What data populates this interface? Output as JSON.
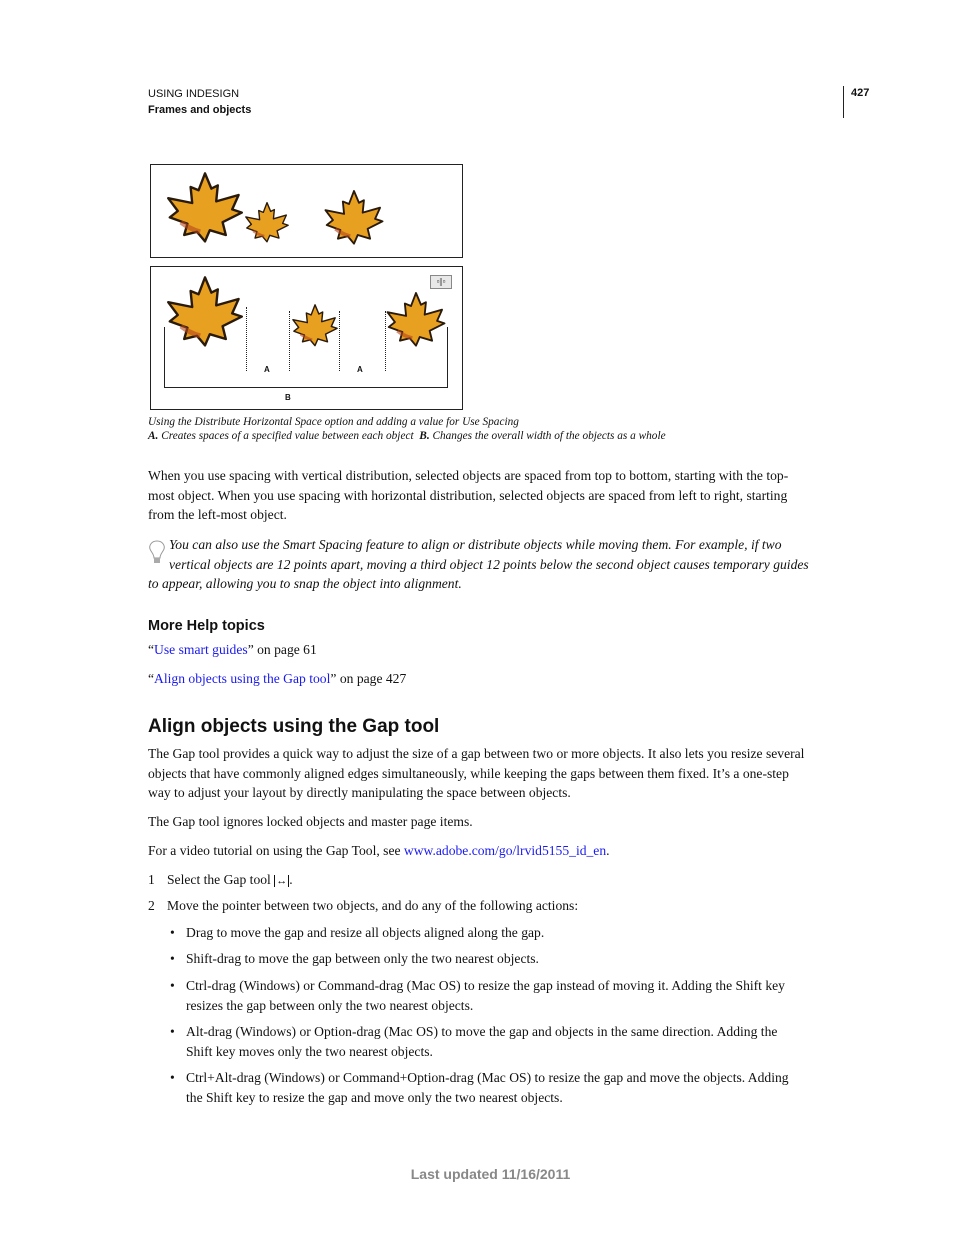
{
  "header": {
    "book": "USING INDESIGN",
    "chapter": "Frames and objects",
    "page_number": "427"
  },
  "figure": {
    "labels": {
      "a1": "A",
      "a2": "A",
      "b": "B"
    },
    "caption_line1": "Using the Distribute Horizontal Space option and adding a value for Use Spacing",
    "caption_a_key": "A.",
    "caption_a_text": "Creates spaces of a specified value between each object",
    "caption_b_key": "B.",
    "caption_b_text": "Changes the overall width of the objects as a whole",
    "leaf_color": "#e8a020",
    "icon": "distribute-horizontal-space-icon"
  },
  "para1": [
    "When you use spacing with vertical distribution, selected objects are spaced from top to bottom, starting with the top-",
    "most object. When you use spacing with horizontal distribution, selected objects are spaced from left to right, starting",
    "from the left-most object."
  ],
  "tip": {
    "icon": "lightbulb-icon",
    "lines": [
      "You can also use the Smart Spacing feature to align or distribute objects while moving them. For example, if two",
      "vertical objects are 12 points apart, moving a third object 12 points below the second object causes temporary guides",
      "to appear, allowing you to snap the object into alignment."
    ]
  },
  "more_help": {
    "title": "More Help topics",
    "links": [
      {
        "text": "Use smart guides",
        "suffix": " on page 61"
      },
      {
        "text": "Align objects using the Gap tool",
        "suffix": " on page 427"
      }
    ]
  },
  "section": {
    "title": "Align objects using the Gap tool",
    "para1": [
      "The Gap tool provides a quick way to adjust the size of a gap between two or more objects. It also lets you resize several",
      "objects that have commonly aligned edges simultaneously, while keeping the gaps between them fixed. It’s a one-step",
      "way to adjust your layout by directly manipulating the space between objects."
    ],
    "para2": "The Gap tool ignores locked objects and master page items.",
    "para3_prefix": "For a video tutorial on using the Gap Tool, see ",
    "para3_link": "www.adobe.com/go/lrvid5155_id_en",
    "para3_suffix": ".",
    "steps": [
      {
        "num": "1",
        "text": "Select the Gap tool ",
        "icon": "gap-tool-icon"
      },
      {
        "num": "2",
        "text": "Move the pointer between two objects, and do any of the following actions:"
      }
    ],
    "bullets": [
      [
        "Drag to move the gap and resize all objects aligned along the gap."
      ],
      [
        "Shift-drag to move the gap between only the two nearest objects."
      ],
      [
        "Ctrl-drag (Windows) or Command-drag (Mac OS) to resize the gap instead of moving it. Adding the Shift key",
        "resizes the gap between only the two nearest objects."
      ],
      [
        "Alt-drag (Windows) or Option-drag (Mac OS) to move the gap and objects in the same direction. Adding the",
        "Shift key moves only the two nearest objects."
      ],
      [
        "Ctrl+Alt-drag (Windows) or Command+Option-drag (Mac OS) to resize the gap and move the objects. Adding",
        "the Shift key to resize the gap and move only the two nearest objects."
      ]
    ]
  },
  "footer": {
    "updated": "Last updated 11/16/2011"
  }
}
